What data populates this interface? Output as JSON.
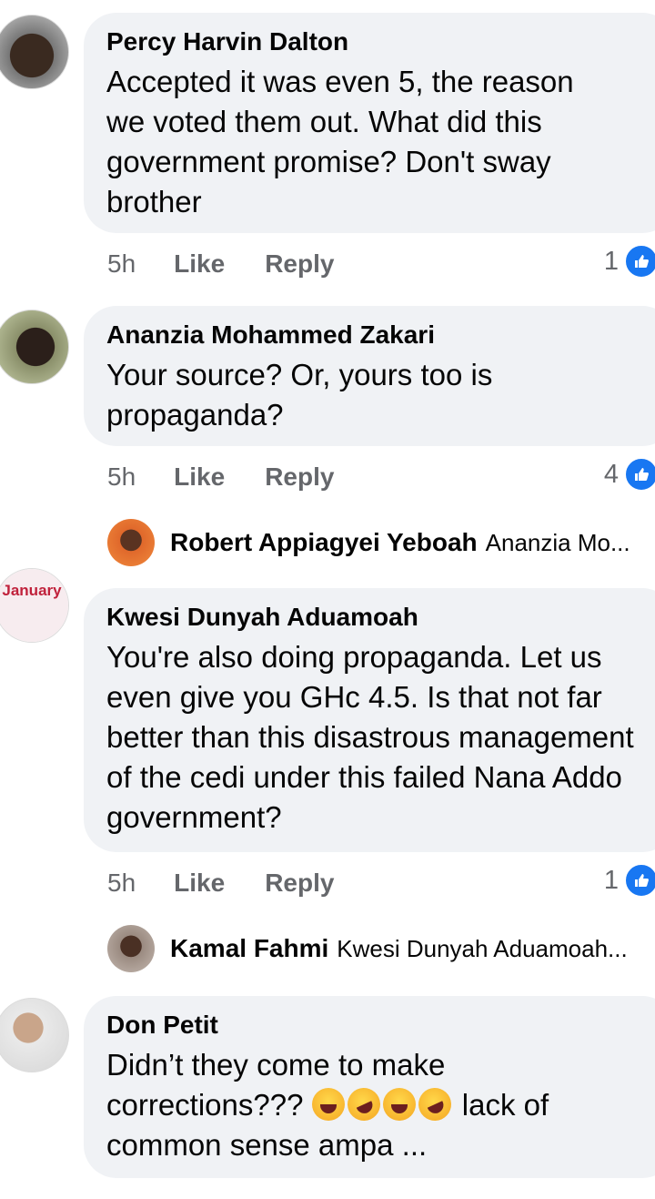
{
  "comments": [
    {
      "author": "Percy Harvin Dalton",
      "text": "Accepted it was even 5, the reason we voted them out.  What did this government promise? Don't sway brother",
      "time": "5h",
      "like": "Like",
      "reply": "Reply",
      "reactions": "1"
    },
    {
      "author": "Ananzia Mohammed Zakari",
      "text": "Your source? Or, yours too is propaganda?",
      "time": "5h",
      "like": "Like",
      "reply": "Reply",
      "reactions": "4",
      "reply_preview": {
        "author": "Robert Appiagyei Yeboah",
        "text": "Ananzia Mo..."
      }
    },
    {
      "author": "Kwesi Dunyah Aduamoah",
      "avatar_text": "January",
      "text": "You're also doing propaganda. Let us even give you GHc 4.5. Is that not far better than this disastrous management of the cedi under this failed Nana Addo government?",
      "time": "5h",
      "like": "Like",
      "reply": "Reply",
      "reactions": "1",
      "reply_preview": {
        "author": "Kamal Fahmi",
        "text": "Kwesi Dunyah Aduamoah..."
      }
    },
    {
      "author": "Don Petit",
      "text_before": "Didn’t they come to make corrections???",
      "text_after": "lack of common sense ampa ..."
    }
  ],
  "colors": {
    "bubble": "#f0f2f5",
    "like_blue": "#1877f2",
    "meta_gray": "#65676b"
  },
  "icons": {
    "reaction": "like-thumb-icon",
    "emoji": "laughing-emoji-icon"
  }
}
